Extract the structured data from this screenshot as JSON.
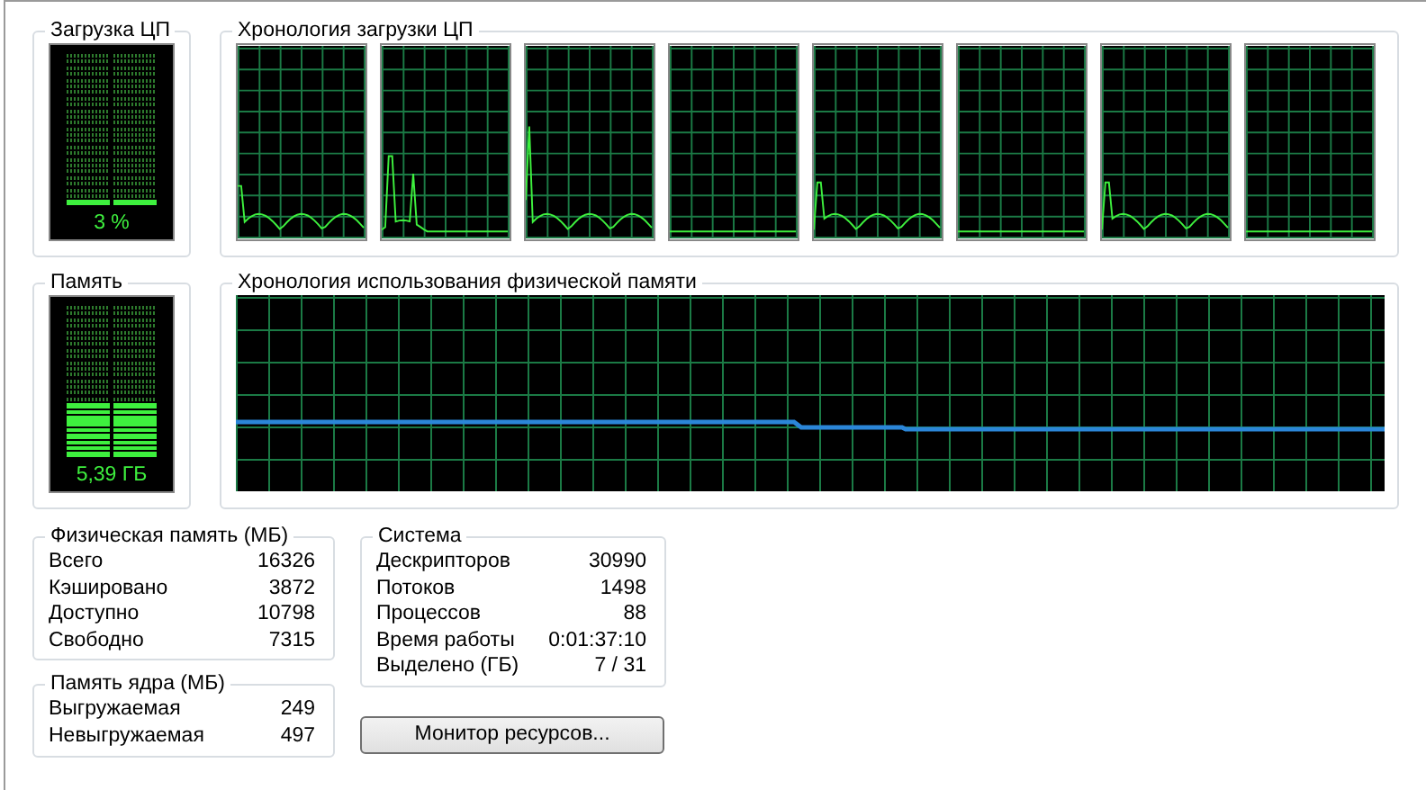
{
  "cpu_usage": {
    "title": "Загрузка ЦП",
    "level": 0.03,
    "reading": "3 %"
  },
  "cpu_history": {
    "title": "Хронология загрузки ЦП"
  },
  "memory": {
    "title": "Память",
    "level": 0.33,
    "reading": "5,39 ГБ"
  },
  "memory_history": {
    "title": "Хронология использования физической памяти"
  },
  "physical_memory": {
    "title": "Физическая память (МБ)",
    "rows": [
      {
        "label": "Всего",
        "value": "16326"
      },
      {
        "label": "Кэшировано",
        "value": "3872"
      },
      {
        "label": "Доступно",
        "value": "10798"
      },
      {
        "label": "Свободно",
        "value": "7315"
      }
    ]
  },
  "kernel_memory": {
    "title": "Память ядра (МБ)",
    "rows": [
      {
        "label": "Выгружаемая",
        "value": "249"
      },
      {
        "label": "Невыгружаемая",
        "value": "497"
      }
    ]
  },
  "system": {
    "title": "Система",
    "rows": [
      {
        "label": "Дескрипторов",
        "value": "30990"
      },
      {
        "label": "Потоков",
        "value": "1498"
      },
      {
        "label": "Процессов",
        "value": "88"
      },
      {
        "label": "Время работы",
        "value": "0:01:37:10"
      },
      {
        "label": "Выделено (ГБ)",
        "value": "7 / 31"
      }
    ]
  },
  "buttons": [
    "Монитор ресурсов..."
  ]
}
